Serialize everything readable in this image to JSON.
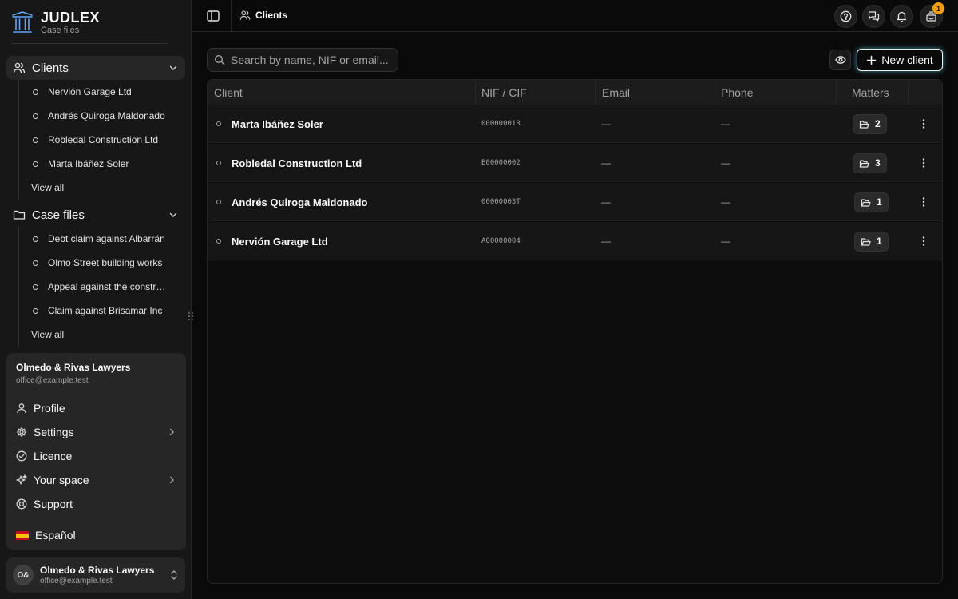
{
  "brand": {
    "name": "JUDLEX",
    "subtitle": "Case files"
  },
  "sidebar": {
    "clients": {
      "label": "Clients",
      "items": [
        "Nervión Garage Ltd",
        "Andrés Quiroga Maldonado",
        "Robledal Construction Ltd",
        "Marta Ibáñez Soler"
      ],
      "view_all": "View all"
    },
    "case_files": {
      "label": "Case files",
      "items": [
        "Debt claim against Albarrán",
        "Olmo Street building works",
        "Appeal against the construction",
        "Claim against Brisamar Inc"
      ],
      "view_all": "View all"
    }
  },
  "user_menu": {
    "name": "Olmedo & Rivas Lawyers",
    "email": "office@example.test",
    "items": [
      {
        "label": "Profile",
        "icon": "user-icon"
      },
      {
        "label": "Settings",
        "icon": "gear-icon"
      },
      {
        "label": "Licence",
        "icon": "badge-check-icon"
      },
      {
        "label": "Your space",
        "icon": "sparkles-icon"
      },
      {
        "label": "Support",
        "icon": "lifebuoy-icon"
      }
    ],
    "language": "Español"
  },
  "account": {
    "initials": "O&",
    "name": "Olmedo & Rivas Lawyers",
    "email": "office@example.test"
  },
  "topbar": {
    "breadcrumb": "Clients",
    "notifications_badge": "1"
  },
  "search": {
    "placeholder": "Search by name, NIF or email..."
  },
  "new_client_label": "New client",
  "table": {
    "columns": [
      "Client",
      "NIF / CIF",
      "Email",
      "Phone",
      "Matters"
    ],
    "rows": [
      {
        "client": "Marta Ibáñez Soler",
        "nif": "00000001R",
        "email": "—",
        "phone": "—",
        "matters": "2"
      },
      {
        "client": "Robledal Construction Ltd",
        "nif": "B00000002",
        "email": "—",
        "phone": "—",
        "matters": "3"
      },
      {
        "client": "Andrés Quiroga Maldonado",
        "nif": "00000003T",
        "email": "—",
        "phone": "—",
        "matters": "1"
      },
      {
        "client": "Nervión Garage Ltd",
        "nif": "A00000004",
        "email": "—",
        "phone": "—",
        "matters": "1"
      }
    ]
  },
  "colors": {
    "accent_badge": "#f59e0b",
    "brand_logo": "#60a5fa"
  }
}
